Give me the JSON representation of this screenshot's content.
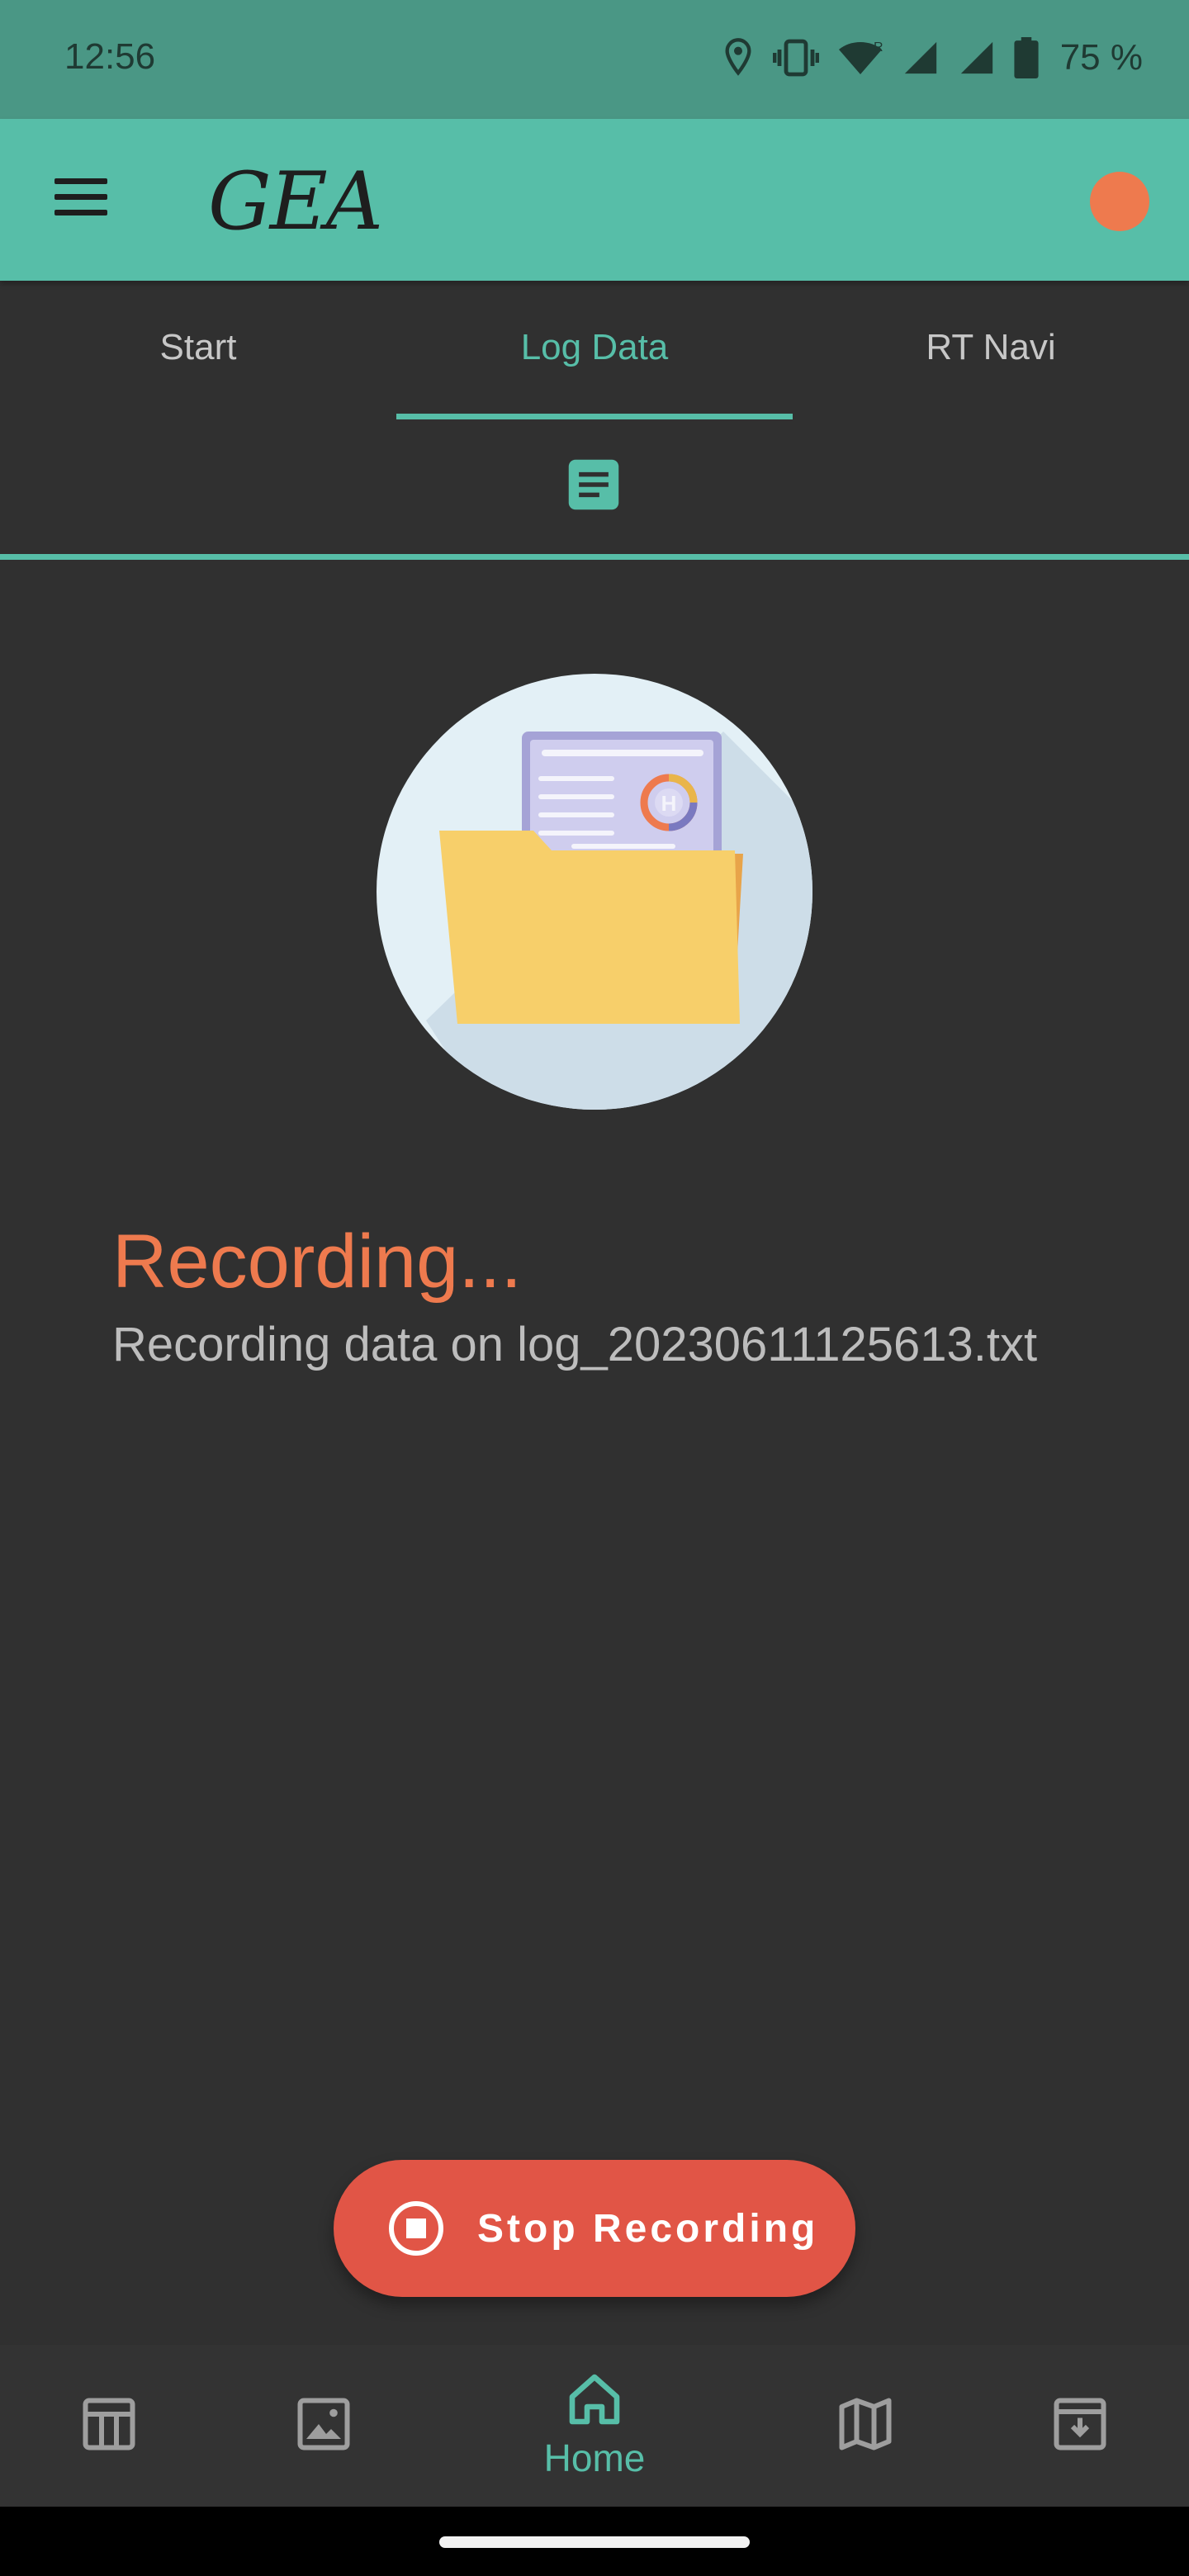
{
  "status_bar": {
    "time": "12:56",
    "battery": "75 %",
    "icons": [
      "location-icon",
      "vibrate-icon",
      "wifi-icon",
      "signal-roaming-icon",
      "signal-icon",
      "battery-icon"
    ]
  },
  "app_bar": {
    "logo": "GEA",
    "menu_icon": "hamburger-menu-icon",
    "status_dot_color": "#ee7a4e"
  },
  "tabs": [
    {
      "label": "Start"
    },
    {
      "label": "Log Data"
    },
    {
      "label": "RT Navi"
    }
  ],
  "active_tab": "Log Data",
  "subtab_icon": "document-icon",
  "recording": {
    "title": "Recording...",
    "subtitle": "Recording data on log_20230611125613.txt"
  },
  "stop_button": {
    "label": "Stop Recording",
    "icon": "stop-circle-icon"
  },
  "bottom_nav": [
    {
      "icon": "table-icon",
      "label": ""
    },
    {
      "icon": "image-icon",
      "label": ""
    },
    {
      "icon": "home-icon",
      "label": "Home"
    },
    {
      "icon": "map-icon",
      "label": ""
    },
    {
      "icon": "archive-download-icon",
      "label": ""
    }
  ],
  "colors": {
    "accent": "#57bea8",
    "status_bar": "#4a9785",
    "background": "#303030",
    "recording": "#ee7a4e",
    "stop_button": "#e15546"
  }
}
